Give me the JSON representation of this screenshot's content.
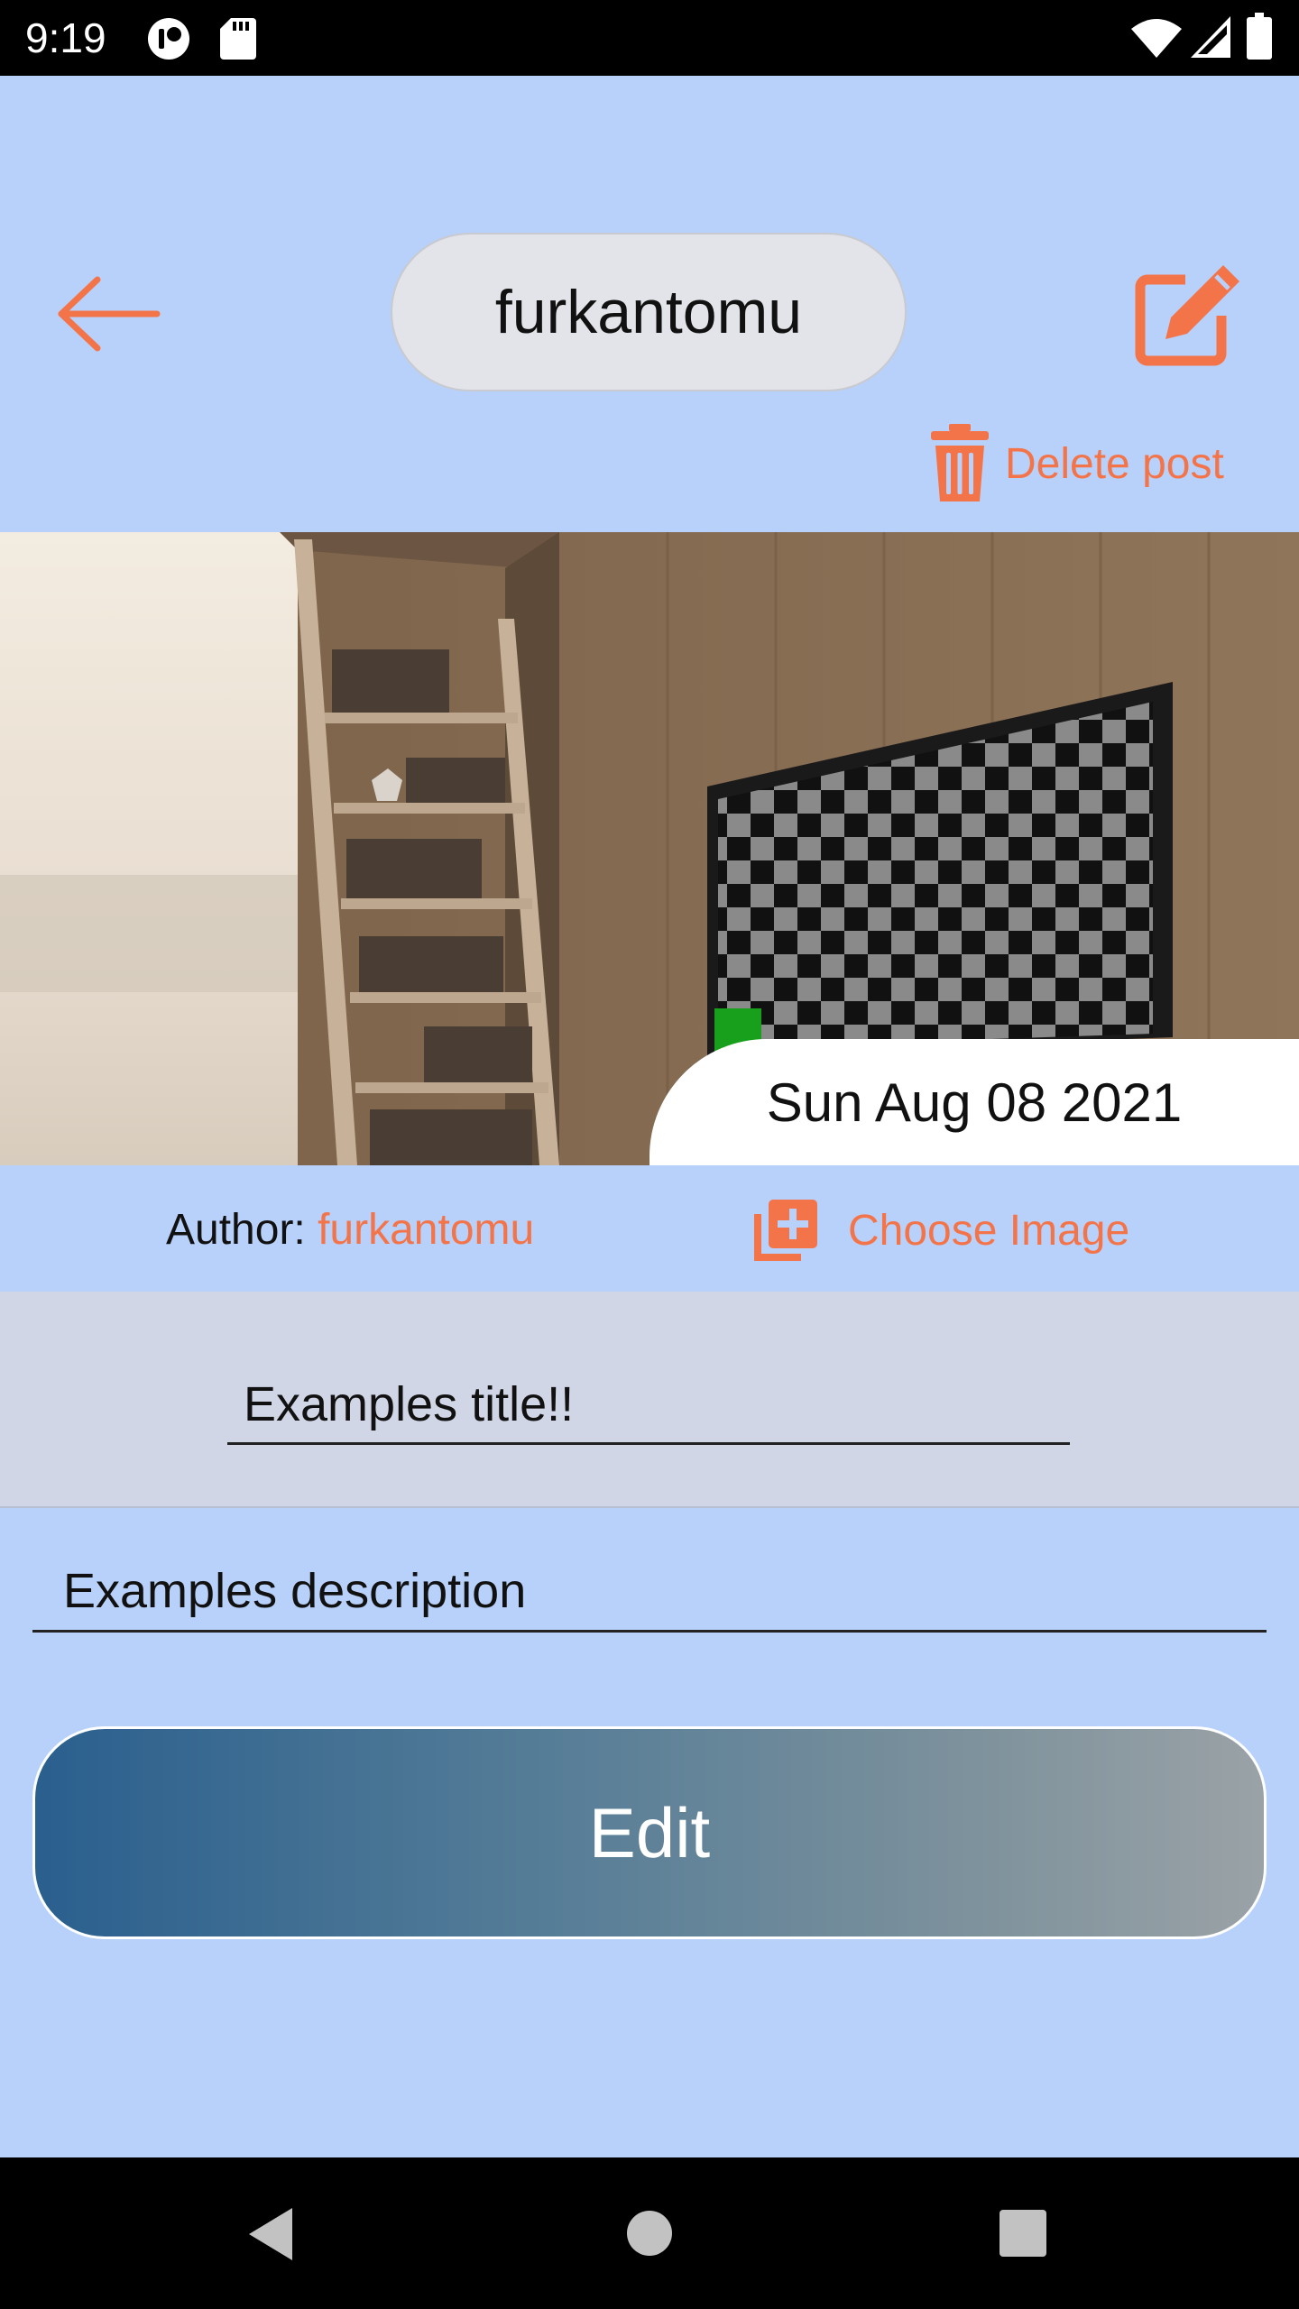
{
  "status_bar": {
    "time": "9:19",
    "icons": [
      "account-circle-icon",
      "sd-card-icon",
      "wifi-icon",
      "cell-signal-icon",
      "battery-icon"
    ]
  },
  "header": {
    "username": "furkantomu",
    "back_icon": "arrow-left-icon",
    "edit_icon": "edit-square-icon"
  },
  "delete_post": {
    "label": "Delete post",
    "icon": "trash-icon"
  },
  "post": {
    "date": "Sun Aug 08 2021",
    "author_label": "Author: ",
    "author_name": "furkantomu",
    "choose_image_label": "Choose Image",
    "choose_image_icon": "add-photo-library-icon",
    "title_value": "Examples title!!",
    "description_value": "Examples description",
    "edit_button_label": "Edit"
  },
  "nav_bar": {
    "icons": [
      "back-triangle-icon",
      "home-circle-icon",
      "recents-square-icon"
    ]
  },
  "colors": {
    "background": "#b8d1fa",
    "accent": "#f4744a",
    "title_section": "#d0d6e6",
    "button_gradient_start": "#2a5f8e",
    "button_gradient_end": "#9aa2a6"
  }
}
